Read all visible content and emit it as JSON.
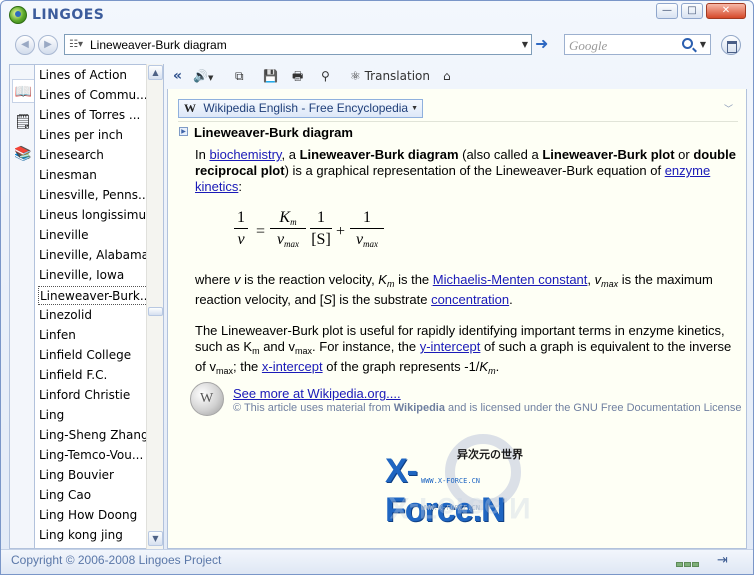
{
  "app": {
    "name": "LINGOES"
  },
  "window_controls": {
    "minimize": "—",
    "maximize": "□",
    "close": "✕"
  },
  "nav": {
    "back": "◀",
    "forward": "▶"
  },
  "address": {
    "value": "Lineweaver-Burk diagram",
    "go_icon": "➜"
  },
  "search": {
    "placeholder": "Google"
  },
  "sidebar": {
    "tabs": [
      {
        "icon": "dictionary-book-icon"
      },
      {
        "icon": "translate-text-icon"
      },
      {
        "icon": "notes-icon"
      }
    ]
  },
  "wordlist": {
    "selected_index": 11,
    "items": [
      "Lines of Action",
      "Lines of Commu...",
      "Lines of Torres ...",
      "Lines per inch",
      "Linesearch",
      "Linesman",
      "Linesville, Penns...",
      "Lineus longissimus",
      "Lineville",
      "Lineville, Alabama",
      "Lineville, Iowa",
      "Lineweaver-Burk...",
      "Linezolid",
      "Linfen",
      "Linfield College",
      "Linfield F.C.",
      "Linford Christie",
      "Ling",
      "Ling-Sheng Zhang",
      "Ling-Temco-Vou...",
      "Ling Bouvier",
      "Ling Cao",
      "Ling How Doong",
      "Ling kong jing"
    ]
  },
  "content_toolbar": {
    "back": "«",
    "translation_label": "Translation"
  },
  "source": {
    "w": "W",
    "label": "Wikipedia English - Free Encyclopedia"
  },
  "entry": {
    "title": "Lineweaver-Burk diagram",
    "p1": {
      "t1": "In ",
      "link1": "biochemistry",
      "t2": ", a ",
      "b1": "Lineweaver-Burk diagram",
      "t3": " (also called a ",
      "b2": "Lineweaver-Burk plot",
      "t4": " or ",
      "b3": "double reciprocal plot",
      "t5": ") is a graphical representation of the Lineweaver-Burk equation of ",
      "link2": "enzyme kinetics",
      "t6": ":"
    },
    "formula": {
      "one": "1",
      "v": "v",
      "eq": "=",
      "km": "K",
      "km_sub": "m",
      "vmax": "v",
      "vmax_sub": "max",
      "s": "[S]",
      "plus": "+"
    },
    "p2": {
      "t1": "where ",
      "v": "v",
      "t2": " is the reaction velocity, ",
      "K": "K",
      "m": "m",
      "t3": " is the ",
      "link1": "Michaelis-Menten constant",
      "t4": ", ",
      "v2": "v",
      "max": "max",
      "t5": " is the maximum reaction velocity, and [",
      "S": "S",
      "t6": "] is the substrate ",
      "link2": "concentration",
      "t7": "."
    },
    "p3": {
      "t1": "The Lineweaver-Burk plot is useful for rapidly identifying important terms in enzyme kinetics, such as K",
      "m": "m",
      "t2": " and v",
      "max": "max",
      "t3": ". For instance, the ",
      "link1": "y-intercept",
      "t4": " of such a graph is equivalent to the inverse of v",
      "max2": "max",
      "t5": "; the ",
      "link2": "x-intercept",
      "t6": " of the graph represents -1/",
      "K": "K",
      "m2": "m",
      "t7": "."
    },
    "see_more": "See more at Wikipedia.org....",
    "license": {
      "t1": "© This article uses material from ",
      "b": "Wikipedia",
      "t2": " and is licensed under the GNU Free Documentation License"
    }
  },
  "watermark": {
    "cn": "异次元の世界",
    "main": "X-Force.N",
    "sub": "WWW.X-FORCE.CN",
    "reflect_main": "X-Force.N",
    "reflect_sub": "WWW.X-FORCE.CN"
  },
  "status": {
    "copyright": "Copyright © 2006-2008 Lingoes Project",
    "pin": "⇥"
  },
  "colors": {
    "accent": "#3c5c9c",
    "link": "#1a1ab8",
    "content_bg": "#fefff5"
  }
}
